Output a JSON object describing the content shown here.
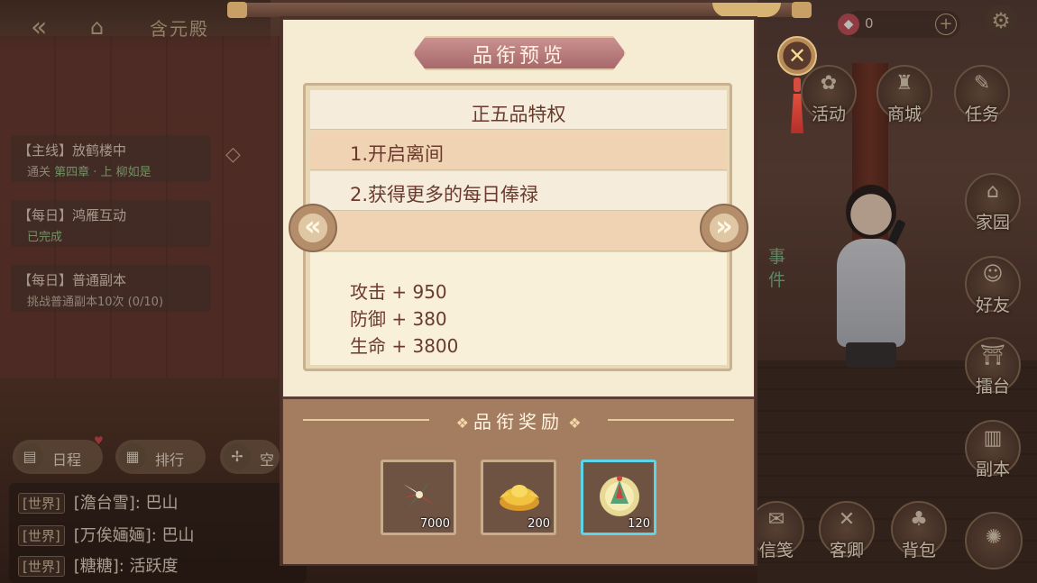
{
  "room": {
    "title": "含元殿"
  },
  "quests": [
    {
      "title": "【主线】放鹤楼中",
      "sub_prefix": "通关 ",
      "sub_highlight": "第四章 · 上 柳如是"
    },
    {
      "title": "【每日】鸿雁互动",
      "status": "已完成"
    },
    {
      "title": "【每日】普通副本",
      "sub": "挑战普通副本10次 (0/10)"
    }
  ],
  "bottom_buttons": [
    {
      "label": "日程",
      "icon": "calendar-icon"
    },
    {
      "label": "排行",
      "icon": "ranking-icon"
    },
    {
      "label": "空",
      "icon": "sparkle-icon"
    }
  ],
  "chat": [
    {
      "channel": "[世界]",
      "text": "[澹台雪]: 巴山"
    },
    {
      "channel": "[世界]",
      "text": "[万俟婳婳]: 巴山"
    },
    {
      "channel": "[世界]",
      "text": "[糖糖]: 活跃度"
    }
  ],
  "status_bar": {
    "gem_count": "0"
  },
  "top_menu": [
    {
      "label": "活动",
      "icon": "activity-icon"
    },
    {
      "label": "商城",
      "icon": "shop-icon"
    },
    {
      "label": "任务",
      "icon": "task-icon"
    }
  ],
  "side_menu": [
    {
      "label": "家园",
      "icon": "home-icon"
    },
    {
      "label": "好友",
      "icon": "friend-icon"
    },
    {
      "label": "擂台",
      "icon": "arena-icon"
    },
    {
      "label": "副本",
      "icon": "dungeon-icon"
    }
  ],
  "bottom_menu": [
    {
      "label": "信笺",
      "icon": "letter-icon"
    },
    {
      "label": "客卿",
      "icon": "retainer-icon"
    },
    {
      "label": "背包",
      "icon": "bag-icon"
    }
  ],
  "event_tag": "事件",
  "modal": {
    "title": "品衔预览",
    "rank_title": "正五品特权",
    "privileges": [
      "1.开启离间",
      "2.获得更多的每日俸禄"
    ],
    "stats": [
      "攻击 + 950",
      "防御 + 380",
      "生命 + 3800"
    ],
    "reward_title": "品衔奖励",
    "rewards": [
      {
        "item": "pinwheel-dart",
        "count": "7000",
        "selected": false
      },
      {
        "item": "gold-ingot",
        "count": "200",
        "selected": false
      },
      {
        "item": "jade-token",
        "count": "120",
        "selected": true
      }
    ]
  },
  "colors": {
    "panel_text": "#6a3a2d",
    "selected_border": "#5fd4e8",
    "title_ribbon": "#b7797b"
  }
}
